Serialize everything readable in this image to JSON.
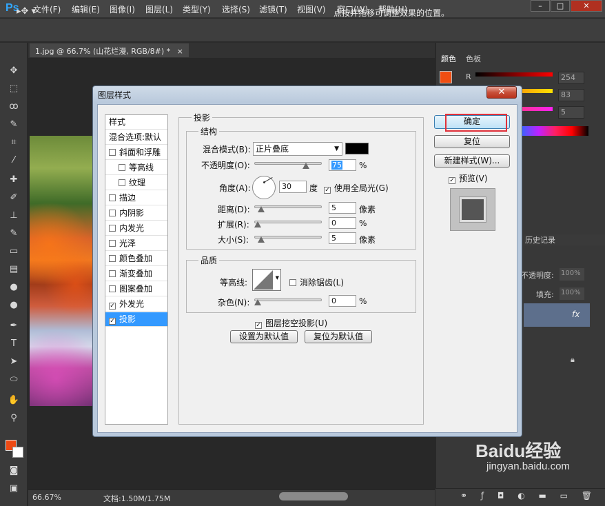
{
  "app": {
    "logo": "Ps",
    "menu": [
      "文件(F)",
      "编辑(E)",
      "图像(I)",
      "图层(L)",
      "类型(Y)",
      "选择(S)",
      "滤镜(T)",
      "视图(V)",
      "窗口(W)",
      "帮助(H)"
    ],
    "window_buttons": [
      "–",
      "□",
      "✕"
    ]
  },
  "options_bar": {
    "tool_icon": "move-tool-icon",
    "hint": "点按并拖移可调整效果的位置。"
  },
  "document": {
    "tab_title": "1.jpg @ 66.7% (山花烂漫, RGB/8#) *",
    "close": "×",
    "zoom": "66.67%",
    "doc_size": "文档:1.50M/1.75M"
  },
  "color_panel": {
    "tabs": [
      "颜色",
      "色板"
    ],
    "channel_label": "R",
    "values": [
      "254",
      "83",
      "5"
    ],
    "foreground": "#f04e12"
  },
  "layers_panel": {
    "history_label": "历史记录",
    "opacity_label": "不透明度:",
    "opacity_value": "100%",
    "fill_label": "填充:",
    "fill_value": "100%",
    "fx": "fx"
  },
  "watermark": {
    "mark": "Baidu经验",
    "url": "jingyan.baidu.com"
  },
  "dialog": {
    "title": "图层样式",
    "close": "✕",
    "style_list": [
      {
        "label": "样式",
        "checkbox": false,
        "checked": false,
        "indent": false,
        "selected": false
      },
      {
        "label": "混合选项:默认",
        "checkbox": false,
        "checked": false,
        "indent": false,
        "selected": false
      },
      {
        "label": "斜面和浮雕",
        "checkbox": true,
        "checked": false,
        "indent": false,
        "selected": false
      },
      {
        "label": "等高线",
        "checkbox": true,
        "checked": false,
        "indent": true,
        "selected": false
      },
      {
        "label": "纹理",
        "checkbox": true,
        "checked": false,
        "indent": true,
        "selected": false
      },
      {
        "label": "描边",
        "checkbox": true,
        "checked": false,
        "indent": false,
        "selected": false
      },
      {
        "label": "内阴影",
        "checkbox": true,
        "checked": false,
        "indent": false,
        "selected": false
      },
      {
        "label": "内发光",
        "checkbox": true,
        "checked": false,
        "indent": false,
        "selected": false
      },
      {
        "label": "光泽",
        "checkbox": true,
        "checked": false,
        "indent": false,
        "selected": false
      },
      {
        "label": "颜色叠加",
        "checkbox": true,
        "checked": false,
        "indent": false,
        "selected": false
      },
      {
        "label": "渐变叠加",
        "checkbox": true,
        "checked": false,
        "indent": false,
        "selected": false
      },
      {
        "label": "图案叠加",
        "checkbox": true,
        "checked": false,
        "indent": false,
        "selected": false
      },
      {
        "label": "外发光",
        "checkbox": true,
        "checked": true,
        "indent": false,
        "selected": false
      },
      {
        "label": "投影",
        "checkbox": true,
        "checked": true,
        "indent": false,
        "selected": true
      }
    ],
    "section_title": "投影",
    "structure": {
      "title": "结构",
      "blend_mode_label": "混合模式(B):",
      "blend_mode_value": "正片叠底",
      "opacity_label": "不透明度(O):",
      "opacity_value": "75",
      "opacity_unit": "%",
      "angle_label": "角度(A):",
      "angle_value": "30",
      "angle_unit": "度",
      "global_light_label": "使用全局光(G)",
      "distance_label": "距离(D):",
      "distance_value": "5",
      "distance_unit": "像素",
      "spread_label": "扩展(R):",
      "spread_value": "0",
      "spread_unit": "%",
      "size_label": "大小(S):",
      "size_value": "5",
      "size_unit": "像素"
    },
    "quality": {
      "title": "品质",
      "contour_label": "等高线:",
      "antialias_label": "消除锯齿(L)",
      "noise_label": "杂色(N):",
      "noise_value": "0",
      "noise_unit": "%"
    },
    "knockout_label": "图层挖空投影(U)",
    "set_default": "设置为默认值",
    "reset_default": "复位为默认值",
    "buttons": {
      "ok": "确定",
      "reset": "复位",
      "new_style": "新建样式(W)...",
      "preview": "预览(V)"
    },
    "slider_levels": {
      "opacity": 0.75,
      "distance": 0.05,
      "spread": 0,
      "size": 0.05,
      "noise": 0
    }
  }
}
